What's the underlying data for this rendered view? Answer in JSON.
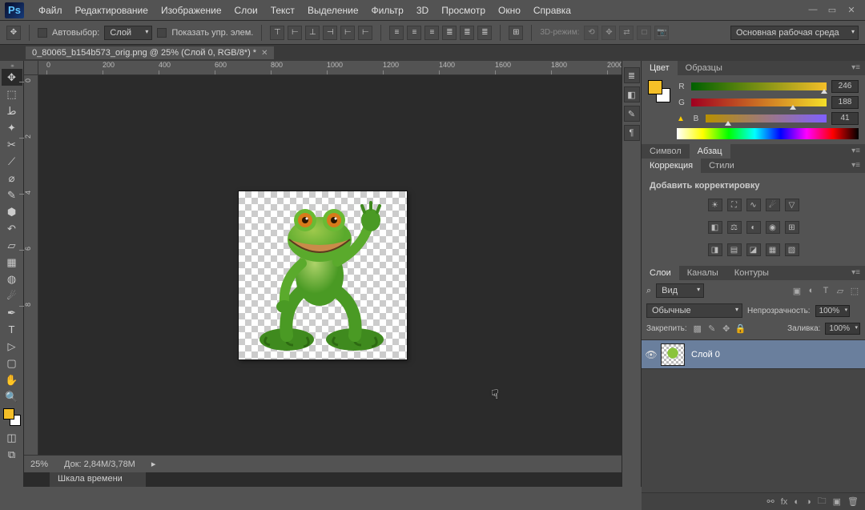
{
  "menu": [
    "Файл",
    "Редактирование",
    "Изображение",
    "Слои",
    "Текст",
    "Выделение",
    "Фильтр",
    "3D",
    "Просмотр",
    "Окно",
    "Справка"
  ],
  "options": {
    "autoselect_label": "Автовыбор:",
    "autoselect_target": "Слой",
    "show_controls": "Показать упр. элем.",
    "mode3d": "3D-режим:"
  },
  "workspace": "Основная рабочая среда",
  "document_tab": "0_80065_b154b573_orig.png @ 25% (Слой 0, RGB/8*) *",
  "ruler_marks_h": [
    "0",
    "200",
    "400",
    "600",
    "800",
    "1000",
    "1200",
    "1400",
    "1600",
    "1800",
    "2000"
  ],
  "ruler_marks_v": [
    "0",
    "2",
    "4",
    "6",
    "8"
  ],
  "zoom": "25%",
  "doc_info": "Док: 2,84M/3,78M",
  "timeline_tab": "Шкала времени",
  "color_panel": {
    "tab1": "Цвет",
    "tab2": "Образцы",
    "r": 246,
    "g": 188,
    "b": 41
  },
  "char_panel": {
    "tab1": "Символ",
    "tab2": "Абзац"
  },
  "adj_panel": {
    "tab1": "Коррекция",
    "tab2": "Стили",
    "title": "Добавить корректировку"
  },
  "layers_panel": {
    "tab1": "Слои",
    "tab2": "Каналы",
    "tab3": "Контуры",
    "filter_label": "Вид",
    "blend_mode": "Обычные",
    "opacity_label": "Непрозрачность:",
    "opacity": "100%",
    "lock_label": "Закрепить:",
    "fill_label": "Заливка:",
    "fill": "100%",
    "layer0": "Слой 0"
  }
}
